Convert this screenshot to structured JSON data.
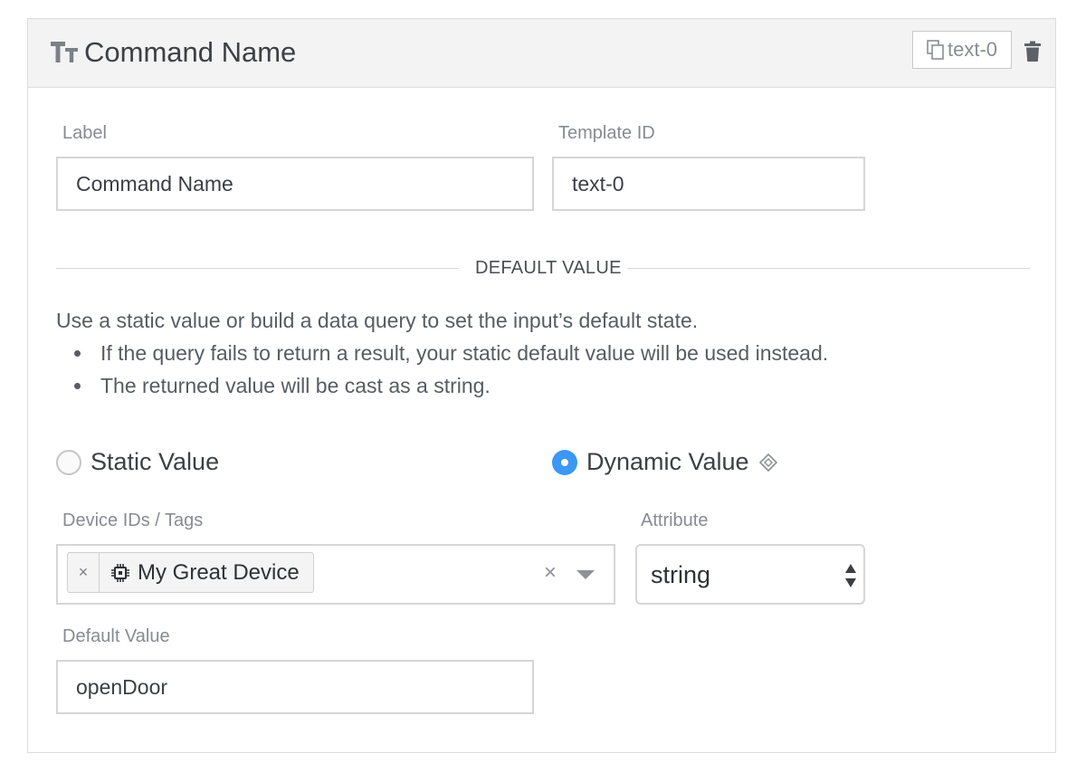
{
  "header": {
    "title": "Command Name",
    "id_badge": "text-0"
  },
  "fields": {
    "label": {
      "label": "Label",
      "value": "Command Name"
    },
    "template_id": {
      "label": "Template ID",
      "value": "text-0"
    }
  },
  "default_value_section": {
    "divider": "DEFAULT VALUE",
    "description": "Use a static value or build a data query to set the input’s default state.",
    "bullets": [
      "If the query fails to return a result, your static default value will be used instead.",
      "The returned value will be cast as a string."
    ]
  },
  "radios": {
    "static": {
      "label": "Static Value",
      "checked": false
    },
    "dynamic": {
      "label": "Dynamic Value",
      "checked": true
    }
  },
  "device_ids": {
    "label": "Device IDs / Tags",
    "tags": [
      "My Great Device"
    ],
    "clear_symbol": "×",
    "tag_remove_symbol": "×"
  },
  "attribute": {
    "label": "Attribute",
    "selected": "string"
  },
  "default_value": {
    "label": "Default Value",
    "value": "openDoor"
  },
  "colors": {
    "accent": "#3c97f5",
    "header_bg": "#f3f3f3",
    "border": "#d6d6d6"
  },
  "icons": {
    "header": "text-type-icon",
    "badge": "copy-icon",
    "delete": "trash-icon",
    "dynamic_info": "diamond-icon",
    "tag": "chip-icon"
  }
}
